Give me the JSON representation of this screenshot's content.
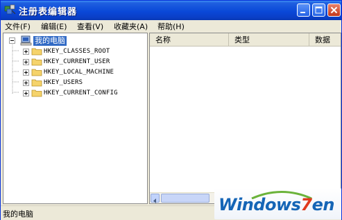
{
  "window": {
    "title": "注册表编辑器"
  },
  "menu": [
    {
      "label": "文件(F)"
    },
    {
      "label": "编辑(E)"
    },
    {
      "label": "查看(V)"
    },
    {
      "label": "收藏夹(A)"
    },
    {
      "label": "帮助(H)"
    }
  ],
  "tree": {
    "root": "我的电脑",
    "keys": [
      "HKEY_CLASSES_ROOT",
      "HKEY_CURRENT_USER",
      "HKEY_LOCAL_MACHINE",
      "HKEY_USERS",
      "HKEY_CURRENT_CONFIG"
    ]
  },
  "list": {
    "columns": [
      "名称",
      "类型",
      "数据"
    ]
  },
  "status": {
    "text": "我的电脑"
  },
  "watermark": {
    "part1": "Windows",
    "part2": "7",
    "part3": "en"
  },
  "colors": {
    "titlebar": "#0A48D8",
    "selection": "#316AC5",
    "folder": "#F5D36B"
  }
}
